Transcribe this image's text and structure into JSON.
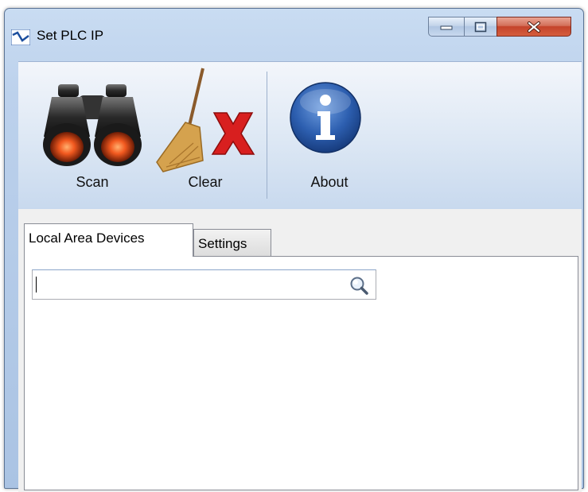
{
  "window": {
    "title": "Set PLC IP"
  },
  "ribbon": {
    "scan_label": "Scan",
    "clear_label": "Clear",
    "about_label": "About"
  },
  "tabs": [
    {
      "label": "Local Area Devices",
      "active": true
    },
    {
      "label": "Settings",
      "active": false
    }
  ],
  "search": {
    "value": ""
  },
  "icons": {
    "app": "waveform-icon",
    "scan": "binoculars-icon",
    "clear": "broom-with-red-x-icon",
    "about": "info-icon",
    "search": "magnifier-icon"
  },
  "colors": {
    "title_bar": "#bcd1ec",
    "close_button": "#c4432b",
    "about_blue": "#2d5fb0"
  }
}
